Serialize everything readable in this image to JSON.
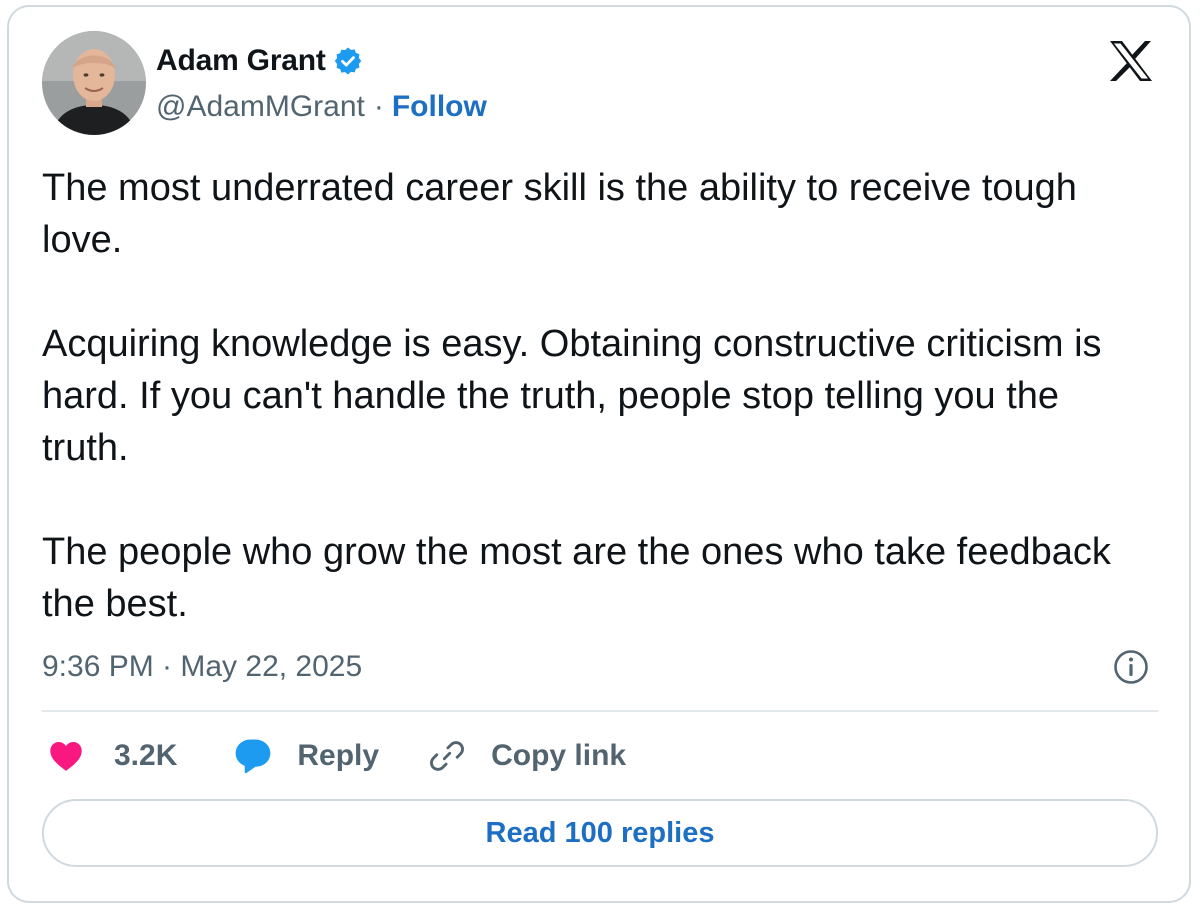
{
  "author": {
    "name": "Adam Grant",
    "handle": "@AdamMGrant",
    "separator": "·",
    "follow_label": "Follow",
    "verified": true,
    "avatar_icon": "profile-photo"
  },
  "platform_logo": "x-logo-icon",
  "tweet": {
    "paragraphs": [
      "The most underrated career skill is the ability to receive tough love.",
      "Acquiring knowledge is easy. Obtaining constructive criticism is hard. If you can't handle the truth, people stop telling you the truth.",
      "The people who grow the most are the ones who take feedback the best."
    ],
    "timestamp": "9:36 PM · May 22, 2025"
  },
  "actions": {
    "likes": "3.2K",
    "reply_label": "Reply",
    "copy_link_label": "Copy link"
  },
  "read_replies_label": "Read 100 replies",
  "colors": {
    "accent": "#1d6fc4",
    "verified_blue": "#1d9bf0",
    "like_pink": "#f91880",
    "muted_text": "#536471",
    "border": "#cfd9de"
  }
}
